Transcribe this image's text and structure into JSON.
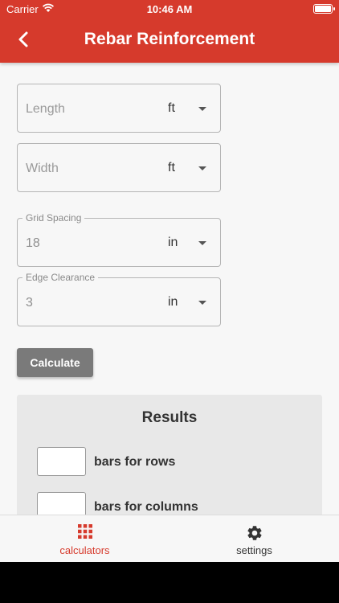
{
  "status_bar": {
    "carrier": "Carrier",
    "time": "10:46 AM"
  },
  "app_bar": {
    "title": "Rebar Reinforcement",
    "back_icon": "chevron-left-icon"
  },
  "form": {
    "length": {
      "placeholder": "Length",
      "unit": "ft"
    },
    "width": {
      "placeholder": "Width",
      "unit": "ft"
    },
    "grid_spacing": {
      "label": "Grid Spacing",
      "value": "18",
      "unit": "in"
    },
    "edge_clearance": {
      "label": "Edge Clearance",
      "value": "3",
      "unit": "in"
    },
    "calculate_label": "Calculate"
  },
  "results": {
    "title": "Results",
    "rows": [
      {
        "label": "bars for rows",
        "value": ""
      },
      {
        "label": "bars for columns",
        "value": ""
      }
    ]
  },
  "bottom_nav": {
    "items": [
      {
        "label": "calculators",
        "icon": "grid-icon",
        "active": true
      },
      {
        "label": "settings",
        "icon": "gear-icon",
        "active": false
      }
    ]
  },
  "colors": {
    "brand": "#d63a2c",
    "button": "#7a7a7a"
  }
}
